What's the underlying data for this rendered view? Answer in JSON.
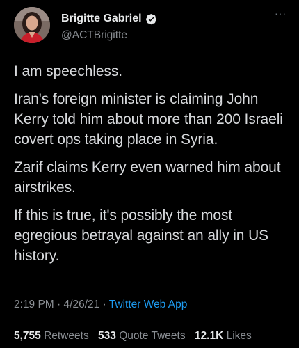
{
  "author": {
    "display_name": "Brigitte Gabriel",
    "handle": "@ACTBrigitte",
    "verified": true
  },
  "icons": {
    "verified": "verified-badge-icon",
    "more": "more-options-icon",
    "avatar": "profile-photo"
  },
  "colors": {
    "background": "#000000",
    "link": "#1d9bf0",
    "muted": "#8b8f94"
  },
  "tweet": {
    "paragraphs": [
      "I am speechless.",
      "Iran's foreign minister is claiming John Kerry told him about more than 200 Israeli covert ops taking place in Syria.",
      "Zarif claims Kerry even warned him about airstrikes.",
      "If this is true, it's possibly the most egregious betrayal against an ally in US history."
    ],
    "time": "2:19 PM",
    "date": "4/26/21",
    "separator": "·",
    "source": "Twitter Web App"
  },
  "stats": {
    "retweets_count": "5,755",
    "retweets_label": "Retweets",
    "quotes_count": "533",
    "quotes_label": "Quote Tweets",
    "likes_count": "12.1K",
    "likes_label": "Likes"
  }
}
